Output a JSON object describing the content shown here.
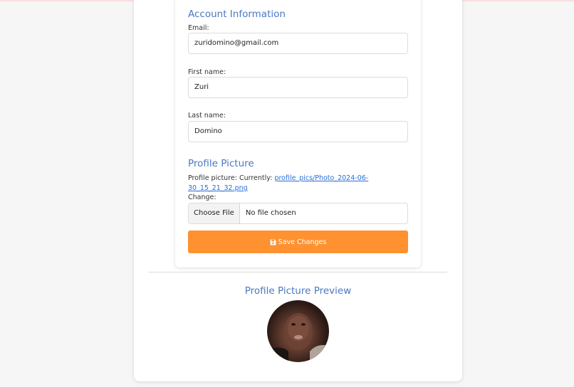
{
  "account": {
    "title": "Account Information",
    "email_label": "Email:",
    "email_value": "zuridomino@gmail.com",
    "first_name_label": "First name:",
    "first_name_value": "Zuri",
    "last_name_label": "Last name:",
    "last_name_value": "Domino"
  },
  "profile": {
    "title": "Profile Picture",
    "current_prefix": "Profile picture: Currently: ",
    "current_link": "profile_pics/Photo_2024-06-30_15_21_32.png",
    "change_label": "Change:",
    "choose_file": "Choose File",
    "no_file": "No file chosen",
    "save_label": "Save Changes",
    "save_icon": "floppy-disk-icon"
  },
  "preview": {
    "title": "Profile Picture Preview"
  },
  "colors": {
    "accent_title": "#4a78c2",
    "button": "#ff9131",
    "link": "#2a6ed8"
  }
}
